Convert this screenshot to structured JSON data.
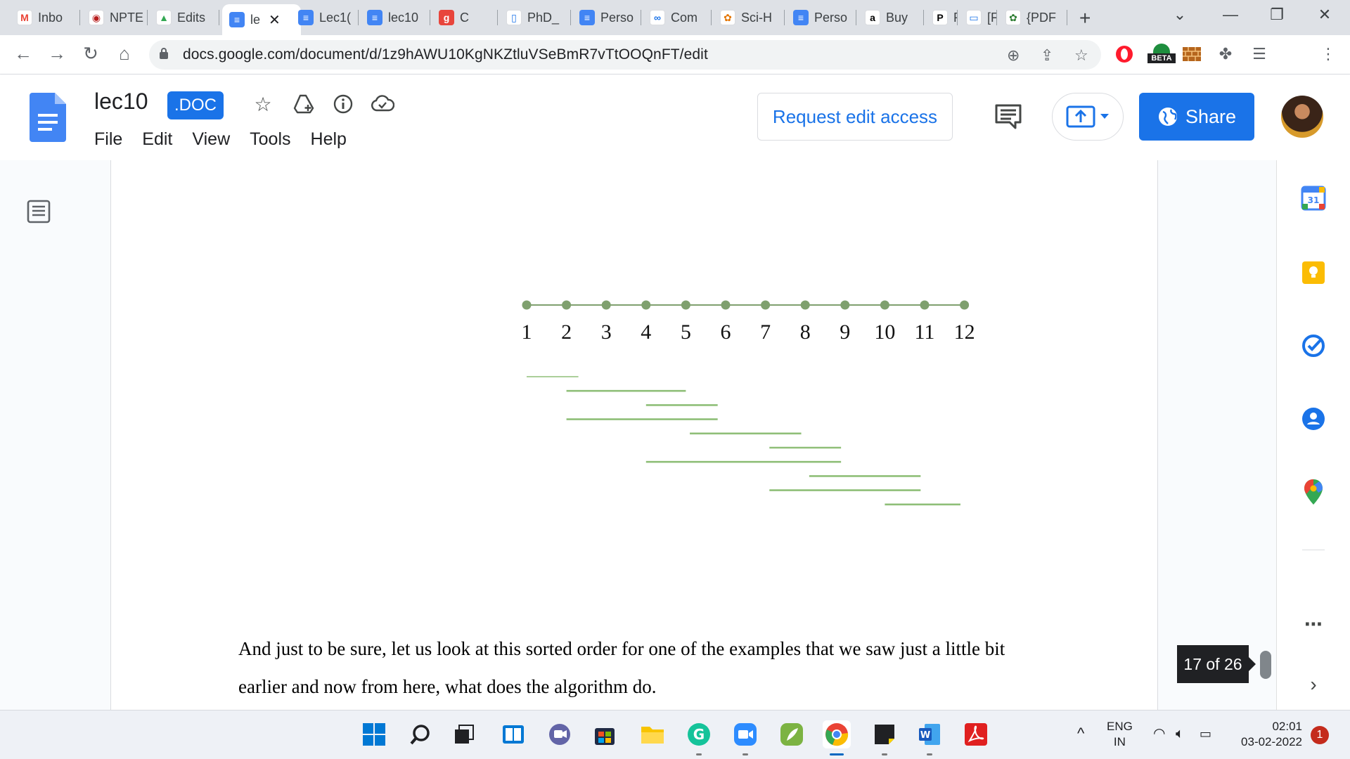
{
  "browser": {
    "tabs": [
      {
        "label": "Inbo",
        "icon": "gmail-icon"
      },
      {
        "label": "NPTE",
        "icon": "nptel-icon"
      },
      {
        "label": "Edits",
        "icon": "drive-icon"
      },
      {
        "label": "le",
        "icon": "docs-icon",
        "active": true
      },
      {
        "label": "Lec1(",
        "icon": "docs-icon"
      },
      {
        "label": "lec10",
        "icon": "docs-icon"
      },
      {
        "label": "C",
        "icon": "g-icon"
      },
      {
        "label": "PhD_",
        "icon": "file-icon"
      },
      {
        "label": "Perso",
        "icon": "docs-icon"
      },
      {
        "label": "Com",
        "icon": "link-icon"
      },
      {
        "label": "Sci-H",
        "icon": "scihub-icon"
      },
      {
        "label": "Perso",
        "icon": "docs-icon"
      },
      {
        "label": "Buy",
        "icon": "amazon-icon"
      },
      {
        "label": "P",
        "icon": "p-icon"
      },
      {
        "label": "[F",
        "icon": "book-icon"
      },
      {
        "label": "{PDF",
        "icon": "pdf-icon"
      }
    ],
    "url": "docs.google.com/document/d/1z9hAWU10KgNKZtluVSeBmR7vTtOOQnFT/edit",
    "beta_label": "BETA"
  },
  "doc": {
    "title": "lec10",
    "badge": ".DOC",
    "menu": [
      "File",
      "Edit",
      "View",
      "Tools",
      "Help"
    ],
    "request_edit": "Request edit access",
    "share": "Share",
    "page_indicator": "17 of 26",
    "body_text": "And just to be sure, let us look at this sorted order for one of the examples that we saw just a little bit earlier and now from here, what does the algorithm do."
  },
  "figure": {
    "timeline_labels": [
      "1",
      "2",
      "3",
      "4",
      "5",
      "6",
      "7",
      "8",
      "9",
      "10",
      "11",
      "12"
    ],
    "intervals": [
      {
        "start": 1,
        "end": 2.3
      },
      {
        "start": 2,
        "end": 5
      },
      {
        "start": 4,
        "end": 5.8
      },
      {
        "start": 2,
        "end": 5.8
      },
      {
        "start": 5.1,
        "end": 7.9
      },
      {
        "start": 7.1,
        "end": 8.9
      },
      {
        "start": 4,
        "end": 8.9
      },
      {
        "start": 8.1,
        "end": 10.9
      },
      {
        "start": 7.1,
        "end": 10.9
      },
      {
        "start": 10,
        "end": 11.9
      }
    ],
    "colors": {
      "dot": "#7fa06e",
      "line": "#8fbf78",
      "axis": "#7fa06e"
    }
  },
  "taskbar": {
    "apps": [
      "windows-start-icon",
      "search-icon",
      "task-view-icon",
      "widgets-icon",
      "chat-icon",
      "store-icon",
      "file-explorer-icon",
      "grammarly-icon",
      "zoom-icon",
      "feather-icon",
      "chrome-icon",
      "sticky-notes-icon",
      "word-icon",
      "acrobat-icon"
    ],
    "lang_top": "ENG",
    "lang_bottom": "IN",
    "time": "02:01",
    "date": "03-02-2022",
    "notifications": "1"
  }
}
